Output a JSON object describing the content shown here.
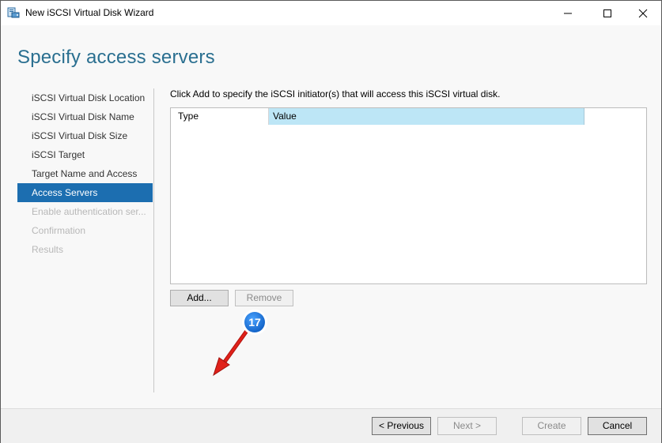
{
  "window": {
    "title": "New iSCSI Virtual Disk Wizard",
    "icon": "wizard-disk-icon"
  },
  "header": {
    "page_title": "Specify access servers"
  },
  "nav": {
    "items": [
      {
        "label": "iSCSI Virtual Disk Location",
        "state": "normal"
      },
      {
        "label": "iSCSI Virtual Disk Name",
        "state": "normal"
      },
      {
        "label": "iSCSI Virtual Disk Size",
        "state": "normal"
      },
      {
        "label": "iSCSI Target",
        "state": "normal"
      },
      {
        "label": "Target Name and Access",
        "state": "normal"
      },
      {
        "label": "Access Servers",
        "state": "active"
      },
      {
        "label": "Enable authentication ser...",
        "state": "disabled"
      },
      {
        "label": "Confirmation",
        "state": "disabled"
      },
      {
        "label": "Results",
        "state": "disabled"
      }
    ]
  },
  "main": {
    "instruction": "Click Add to specify the iSCSI initiator(s) that will access this iSCSI virtual disk.",
    "list": {
      "columns": [
        "Type",
        "Value"
      ],
      "rows": []
    },
    "add_label": "Add...",
    "remove_label": "Remove"
  },
  "footer": {
    "previous_label": "< Previous",
    "next_label": "Next >",
    "create_label": "Create",
    "cancel_label": "Cancel"
  },
  "annotation": {
    "number": "17",
    "colors": {
      "badge": "#1a73d9",
      "arrow": "#e0211a"
    }
  }
}
